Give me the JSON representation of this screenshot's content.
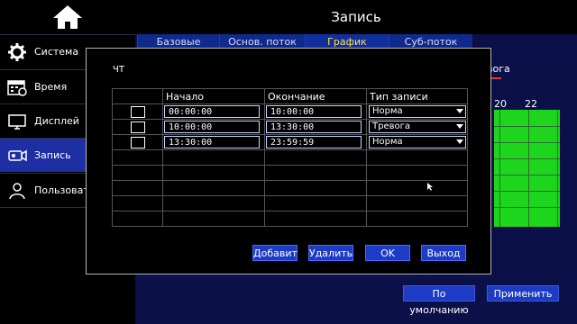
{
  "page": {
    "title": "Запись"
  },
  "sidebar": {
    "items": [
      {
        "label": "Система",
        "icon": "gear-icon"
      },
      {
        "label": "Время",
        "icon": "calendar-icon"
      },
      {
        "label": "Дисплей",
        "icon": "monitor-icon"
      },
      {
        "label": "Запись",
        "icon": "camera-icon",
        "active": true
      },
      {
        "label": "Пользоват",
        "icon": "user-icon"
      }
    ]
  },
  "tabs": [
    {
      "label": "Базовые"
    },
    {
      "label": "Основ. поток"
    },
    {
      "label": "График",
      "active": true
    },
    {
      "label": "Суб-поток"
    }
  ],
  "background": {
    "record_type_tab": "вога",
    "hours": [
      "20",
      "22"
    ],
    "default_button": "По умолчанию",
    "apply_button": "Применить"
  },
  "dialog": {
    "weekday": "ЧТ",
    "headers": {
      "start": "Начало",
      "end": "Окончание",
      "type": "Тип записи"
    },
    "rows": [
      {
        "start": "00:00:00",
        "end": "10:00:00",
        "type": "Норма"
      },
      {
        "start": "10:00:00",
        "end": "13:30:00",
        "type": "Тревога"
      },
      {
        "start": "13:30:00",
        "end": "23:59:59",
        "type": "Норма"
      }
    ],
    "buttons": {
      "add": "Добавит",
      "delete": "Удалить",
      "ok": "OK",
      "exit": "Выход"
    }
  },
  "colors": {
    "accent": "#1d3bc4",
    "active_tab_text": "#ffe34d",
    "schedule_fill": "#1ed51e",
    "sidebar_active": "#1d2fa3"
  }
}
